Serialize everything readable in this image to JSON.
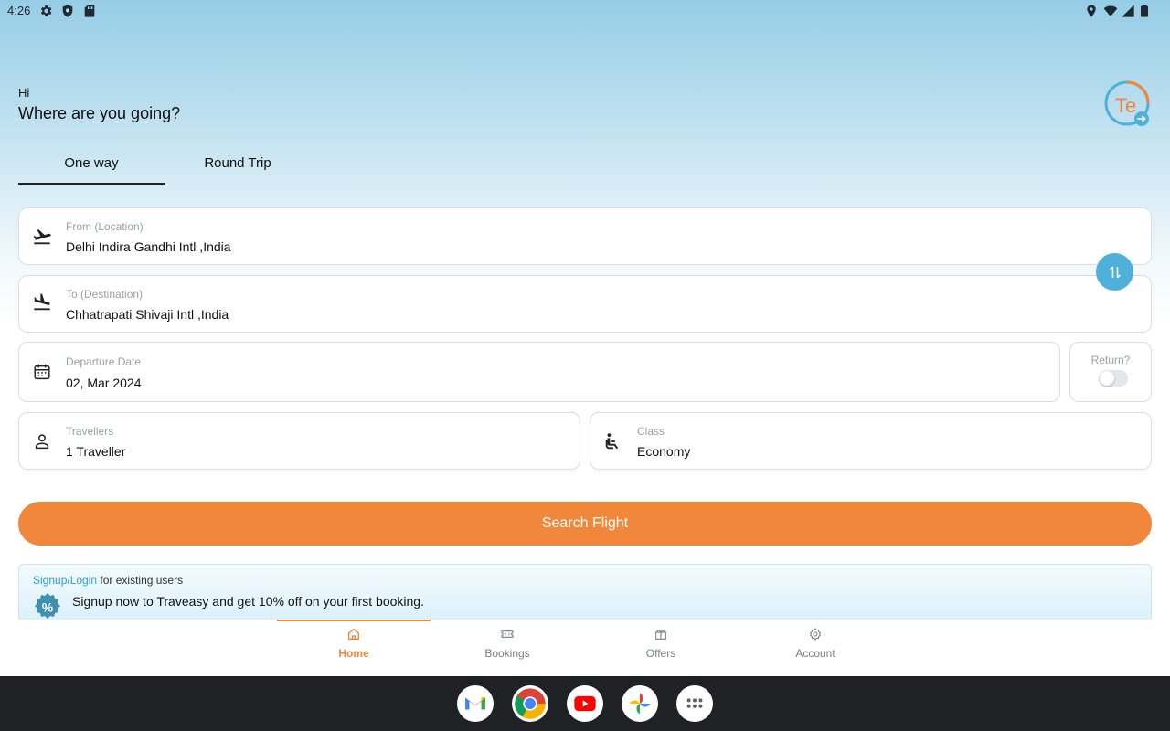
{
  "status_bar": {
    "time": "4:26",
    "left_icons": [
      "gear-icon",
      "shield-icon",
      "sd-card-icon"
    ],
    "right_icons": [
      "location-icon",
      "wifi-icon",
      "signal-icon",
      "battery-icon"
    ]
  },
  "greeting": {
    "hi": "Hi",
    "title": "Where are you going?"
  },
  "logo_text": "Te",
  "tabs": [
    {
      "label": "One way",
      "active": true
    },
    {
      "label": "Round Trip",
      "active": false
    }
  ],
  "form": {
    "from": {
      "label": "From (Location)",
      "value": "Delhi Indira Gandhi Intl ,India"
    },
    "to": {
      "label": "To (Destination)",
      "value": "Chhatrapati Shivaji Intl ,India"
    },
    "departure": {
      "label": "Departure Date",
      "value": "02, Mar 2024"
    },
    "return": {
      "label": "Return?",
      "enabled": false
    },
    "travellers": {
      "label": "Travellers",
      "value": "1 Traveller"
    },
    "class": {
      "label": "Class",
      "value": "Economy"
    }
  },
  "search_button": "Search Flight",
  "promo": {
    "link": "Signup/Login",
    "line1_rest": " for existing users",
    "badge": "%",
    "line2": "Signup now to Traveasy and get 10% off on your first booking."
  },
  "bottom_nav": [
    {
      "label": "Home",
      "icon": "home-icon",
      "active": true
    },
    {
      "label": "Bookings",
      "icon": "ticket-icon",
      "active": false
    },
    {
      "label": "Offers",
      "icon": "gift-icon",
      "active": false
    },
    {
      "label": "Account",
      "icon": "gear-icon",
      "active": false
    }
  ],
  "dock": [
    "gmail-icon",
    "chrome-icon",
    "youtube-icon",
    "photos-icon",
    "app-drawer-icon"
  ],
  "colors": {
    "accent": "#f0873b",
    "swap_button": "#4fb0d9",
    "link": "#2a9fd6"
  }
}
